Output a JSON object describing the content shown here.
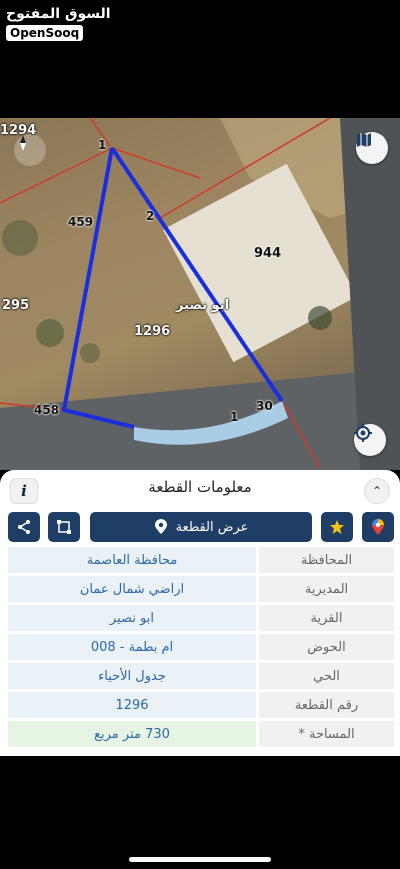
{
  "watermark": {
    "arabic": "السوق المفتوح",
    "english": "OpenSooq"
  },
  "map": {
    "parcel_numbers": {
      "top_left": "1294",
      "left": "295",
      "center": "1296",
      "neighbor": "944"
    },
    "vertex_labels": {
      "v1": "1",
      "v2": "2",
      "v459": "459",
      "v458": "458",
      "v30": "30",
      "v1b": "1"
    },
    "area_name": "ابو نصير",
    "colors": {
      "parcel_outline": "#1a2ee0",
      "road": "#a8cde4",
      "boundary": "#d23a2a"
    }
  },
  "panel": {
    "title": "معلومات القطعة",
    "info_label": "i",
    "show_plot_label": "عرض القطعة",
    "rows": [
      {
        "label": "المحافظة",
        "value": "محافظة العاصمة"
      },
      {
        "label": "المديرية",
        "value": "اراضي شمال عمان"
      },
      {
        "label": "القرية",
        "value": "ابو نصير"
      },
      {
        "label": "الحوض",
        "value": "ام بطمة - 008"
      },
      {
        "label": "الحي",
        "value": "جدول الأحياء"
      },
      {
        "label": "رقم القطعة",
        "value": "1296"
      },
      {
        "label": "المساحة *",
        "value": "730  متر مربع"
      }
    ]
  }
}
